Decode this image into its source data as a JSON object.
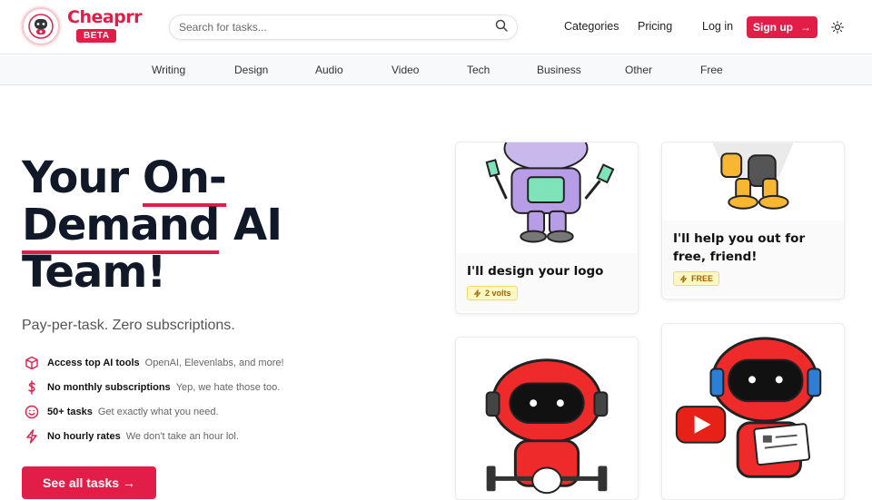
{
  "brand": {
    "name": "Cheaprr",
    "badge": "BETA"
  },
  "search": {
    "placeholder": "Search for tasks..."
  },
  "nav": {
    "categories": "Categories",
    "pricing": "Pricing",
    "login": "Log in",
    "signup": "Sign up",
    "signup_arrow": "→"
  },
  "categories": [
    "Writing",
    "Design",
    "Audio",
    "Video",
    "Tech",
    "Business",
    "Other",
    "Free"
  ],
  "hero": {
    "title_1": "Your ",
    "title_hl1": "On-",
    "title_hl2": "Demand",
    "title_2": " AI",
    "title_3": "Team!",
    "subtitle": "Pay-per-task. Zero subscriptions."
  },
  "features": [
    {
      "icon": "box-icon",
      "title": "Access top AI tools",
      "desc": "OpenAI, Elevenlabs, and more!"
    },
    {
      "icon": "dollar-icon",
      "title": "No monthly subscriptions",
      "desc": "Yep, we hate those too."
    },
    {
      "icon": "smile-icon",
      "title": "50+ tasks",
      "desc": "Get exactly what you need."
    },
    {
      "icon": "lightning-icon",
      "title": "No hourly rates",
      "desc": "We don't take an hour lol."
    }
  ],
  "cta": {
    "label": "See all tasks →"
  },
  "cards": [
    {
      "title": "I'll design your logo",
      "price": "2 volts"
    },
    {
      "title": "I'll help you out for free, friend!",
      "price": "FREE"
    }
  ],
  "colors": {
    "accent": "#e11d48",
    "chip_bg": "#fef9c3",
    "chip_text": "#a16207"
  }
}
